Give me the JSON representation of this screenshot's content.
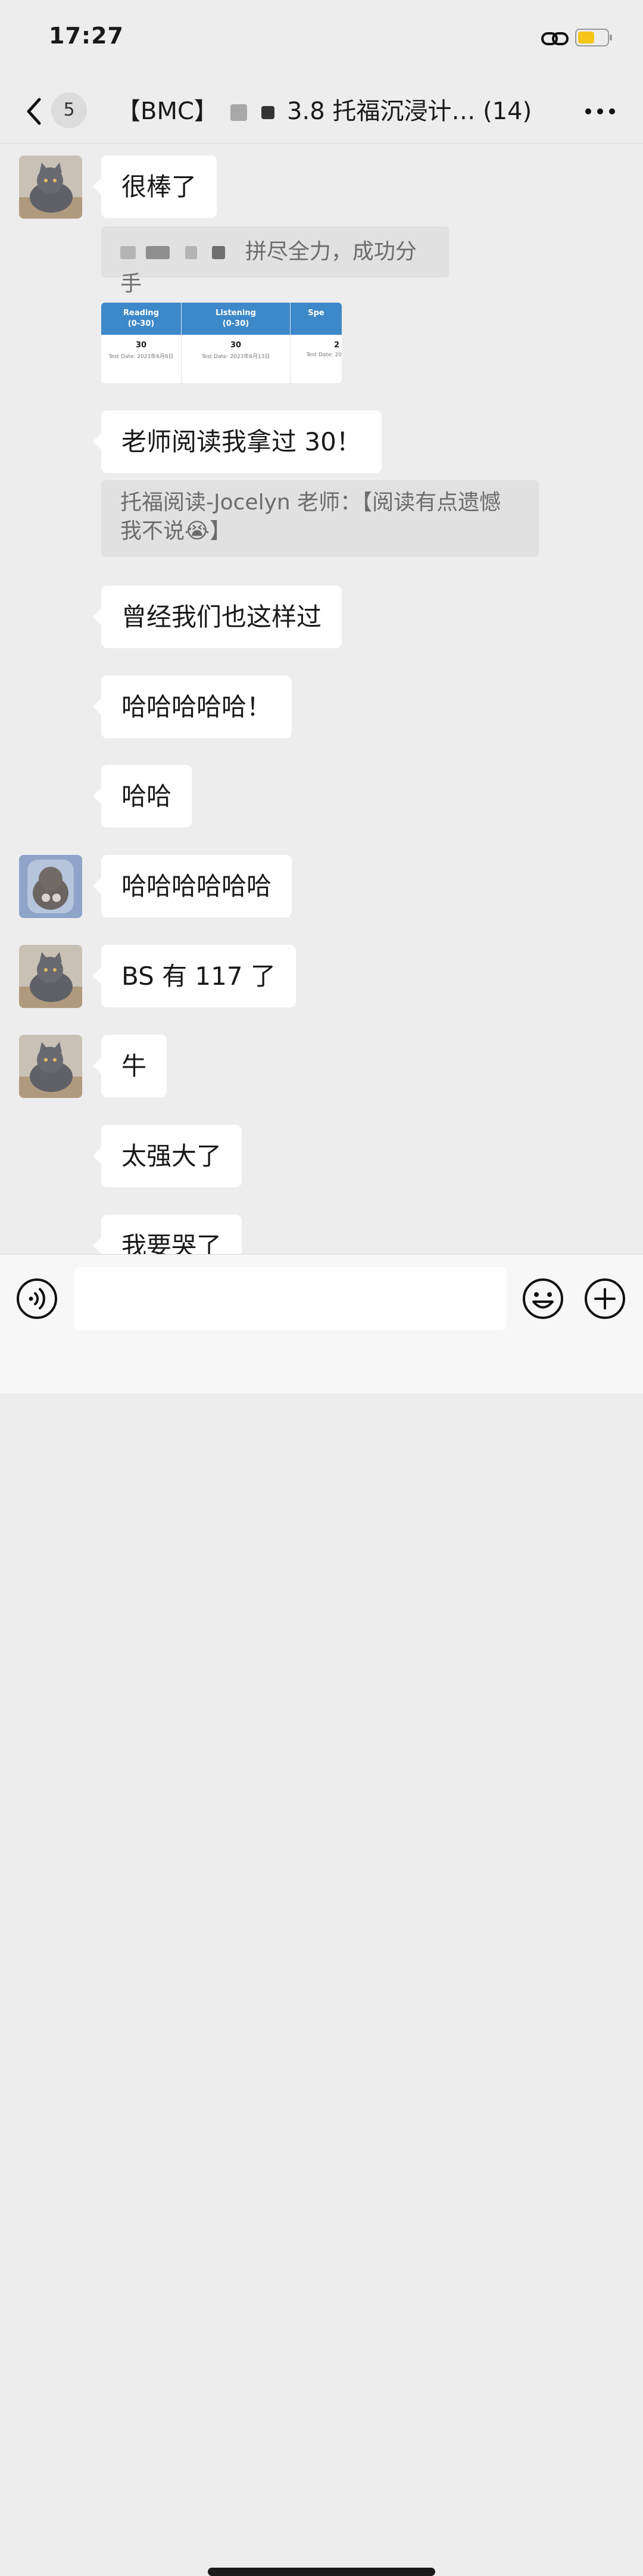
{
  "status_bar": {
    "time": "17:27"
  },
  "nav": {
    "unread_count": "5",
    "title_prefix": "【BMC】",
    "title_suffix": "3.8 托福沉浸计… (14)"
  },
  "score_report": {
    "columns": [
      {
        "header": "Reading\n(0-30)",
        "score": "30",
        "date": "Test Date: 2023年6月6日"
      },
      {
        "header": "Listening\n(0-30)",
        "score": "30",
        "date": "Test Date: 2023年6月13日"
      },
      {
        "header": "Spe",
        "score": "2",
        "date": "Test Date: 20"
      }
    ]
  },
  "messages": [
    {
      "text": "很棒了"
    },
    {
      "quote": "拼尽全力，成功分手"
    },
    {
      "text": "老师阅读我拿过 30！"
    },
    {
      "quote": "托福阅读-Jocelyn 老师：【阅读有点遗憾我不说😭】"
    },
    {
      "text": "曾经我们也这样过"
    },
    {
      "text": "哈哈哈哈哈！"
    },
    {
      "text": "哈哈"
    },
    {
      "text": "哈哈哈哈哈哈"
    },
    {
      "text": "BS 有 117 了"
    },
    {
      "text": "牛"
    },
    {
      "text": "太强大了"
    },
    {
      "text": "我要哭了"
    }
  ],
  "input": {
    "placeholder": ""
  },
  "colors": {
    "background": "#ededed",
    "bubble": "#ffffff",
    "quote": "#e1e1e1",
    "battery": "#f5c518",
    "table_header": "#3d88c8"
  },
  "icons": [
    "back-chevron-icon",
    "link-icon",
    "battery-icon",
    "more-icon",
    "voice-icon",
    "emoji-icon",
    "plus-icon",
    "cat-avatar"
  ]
}
